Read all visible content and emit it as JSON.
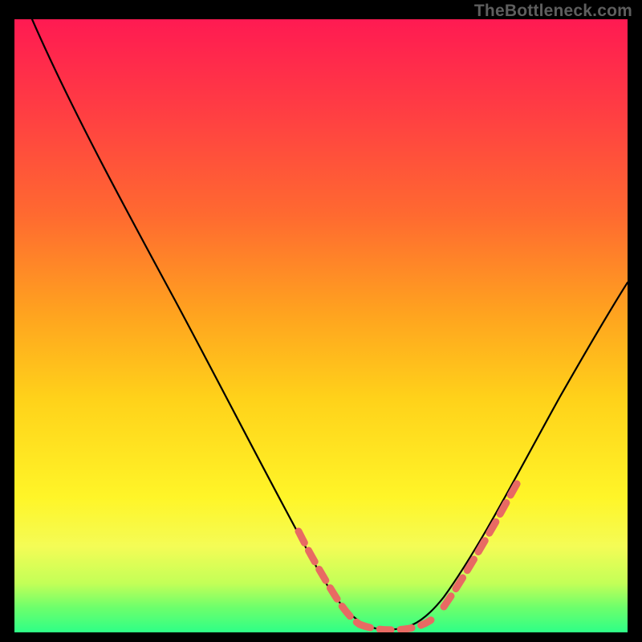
{
  "attribution": "TheBottleneck.com",
  "gradient": {
    "top": "#ff1a52",
    "upper": "#ff6a30",
    "mid": "#ffd21a",
    "lower": "#f4fc56",
    "bottom": "#2eff87"
  },
  "chart_data": {
    "type": "line",
    "title": "",
    "xlabel": "",
    "ylabel": "",
    "xlim": [
      0,
      100
    ],
    "ylim": [
      0,
      100
    ],
    "grid": false,
    "legend": false,
    "series": [
      {
        "name": "curve",
        "color": "#000000",
        "x": [
          3,
          10,
          20,
          30,
          40,
          45,
          50,
          53,
          55,
          57,
          60,
          64,
          68,
          72,
          76,
          80,
          86,
          92,
          98,
          100
        ],
        "y": [
          100,
          88,
          72,
          55,
          35,
          25,
          14,
          8,
          4,
          2,
          0,
          0,
          3,
          7,
          14,
          22,
          33,
          44,
          54,
          58
        ]
      }
    ],
    "highlights": [
      {
        "name": "left-dashes",
        "color": "#e86a63",
        "style": "dashed",
        "x_range": [
          48,
          56
        ],
        "y_range": [
          18,
          3
        ]
      },
      {
        "name": "bottom-dashes",
        "color": "#e86a63",
        "style": "dashed",
        "x_range": [
          56,
          69
        ],
        "y_range": [
          3,
          4
        ]
      },
      {
        "name": "right-dashes",
        "color": "#e86a63",
        "style": "dashed",
        "x_range": [
          70,
          81
        ],
        "y_range": [
          5,
          23
        ]
      }
    ]
  }
}
